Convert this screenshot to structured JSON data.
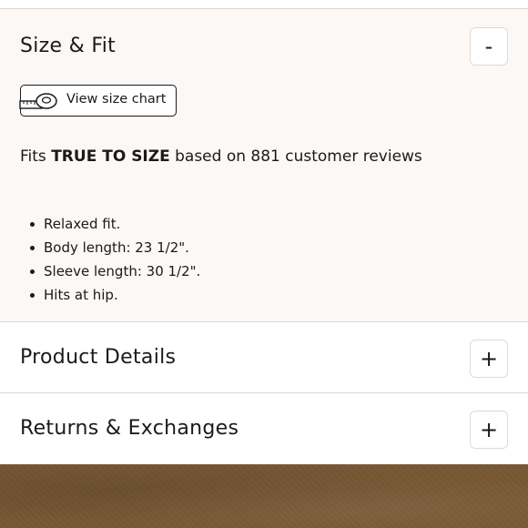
{
  "size_fit": {
    "title": "Size & Fit",
    "toggle_symbol": "-",
    "size_chart_label": "View size chart",
    "fit_prefix": "Fits",
    "fit_highlight": "TRUE TO SIZE",
    "fit_suffix": "based on 881 customer reviews",
    "bullets": [
      "Relaxed fit.",
      "Body length: 23 1/2\".",
      "Sleeve length: 30 1/2\".",
      "Hits at hip."
    ]
  },
  "product_details": {
    "title": "Product Details",
    "toggle_symbol": "+"
  },
  "returns": {
    "title": "Returns & Exchanges",
    "toggle_symbol": "+"
  },
  "icons": {
    "size_chart": "measuring-tape-icon",
    "photo": "fabric-texture"
  },
  "colors": {
    "open_panel_bg": "#fbf8f5",
    "divider": "#dcd8d4",
    "photo_tone": "#7a5a36",
    "text": "#1a1a1a"
  }
}
